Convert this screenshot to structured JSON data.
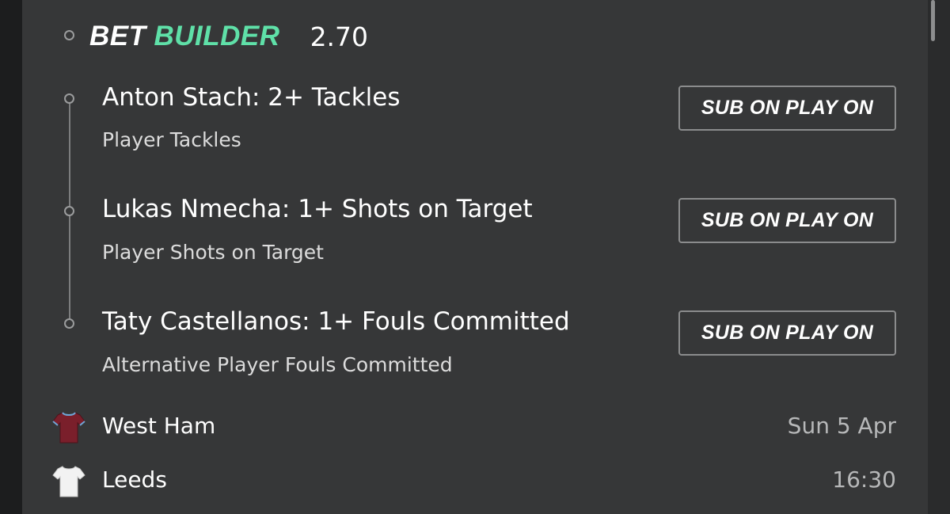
{
  "header": {
    "brand_bet": "BET",
    "brand_builder": "BUILDER",
    "odds": "2.70"
  },
  "selections": [
    {
      "title": "Anton Stach: 2+ Tackles",
      "market": "Player Tackles",
      "button_label": "SUB ON PLAY ON"
    },
    {
      "title": "Lukas Nmecha: 1+ Shots on Target",
      "market": "Player Shots on Target",
      "button_label": "SUB ON PLAY ON"
    },
    {
      "title": "Taty Castellanos: 1+ Fouls Committed",
      "market": "Alternative Player Fouls Committed",
      "button_label": "SUB ON PLAY ON"
    }
  ],
  "match": {
    "home": {
      "name": "West Ham",
      "meta": "Sun 5 Apr",
      "shirt_icon": "claret-shirt-icon",
      "shirt_color": "#7a1f2b"
    },
    "away": {
      "name": "Leeds",
      "meta": "16:30",
      "shirt_icon": "white-shirt-icon",
      "shirt_color": "#f2f2f2"
    }
  },
  "colors": {
    "panel_bg": "#363738",
    "accent_green": "#5fe0a8",
    "text_primary": "#ffffff",
    "text_muted": "#b7b8b9"
  }
}
